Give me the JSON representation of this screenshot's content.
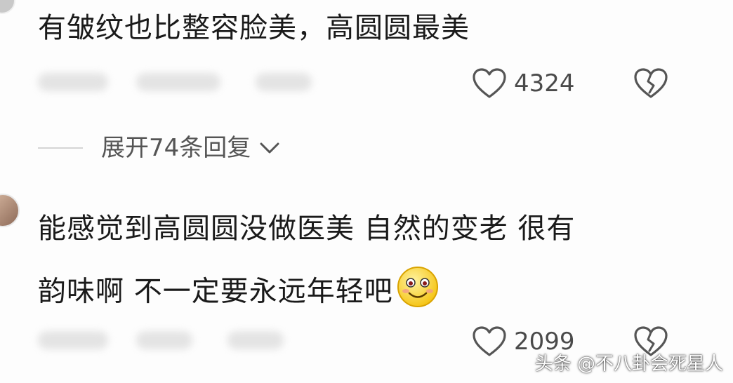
{
  "comments": [
    {
      "text": "有皱纹也比整容脸美，高圆圆最美",
      "likes": "4324",
      "expand_label": "展开74条回复"
    },
    {
      "text_line1": "能感觉到高圆圆没做医美 自然的变老 很有",
      "text_line2": "韵味啊 不一定要永远年轻吧",
      "likes": "2099",
      "emoji": "smiling-face-emoji"
    }
  ],
  "watermark": "头条 @不八卦会死星人",
  "icons": {
    "like": "heart-outline-icon",
    "dislike": "broken-heart-icon",
    "expand": "chevron-down-icon"
  },
  "colors": {
    "text": "#1a1a1a",
    "meta": "#4a4a4a",
    "icon_stroke": "#555555"
  }
}
